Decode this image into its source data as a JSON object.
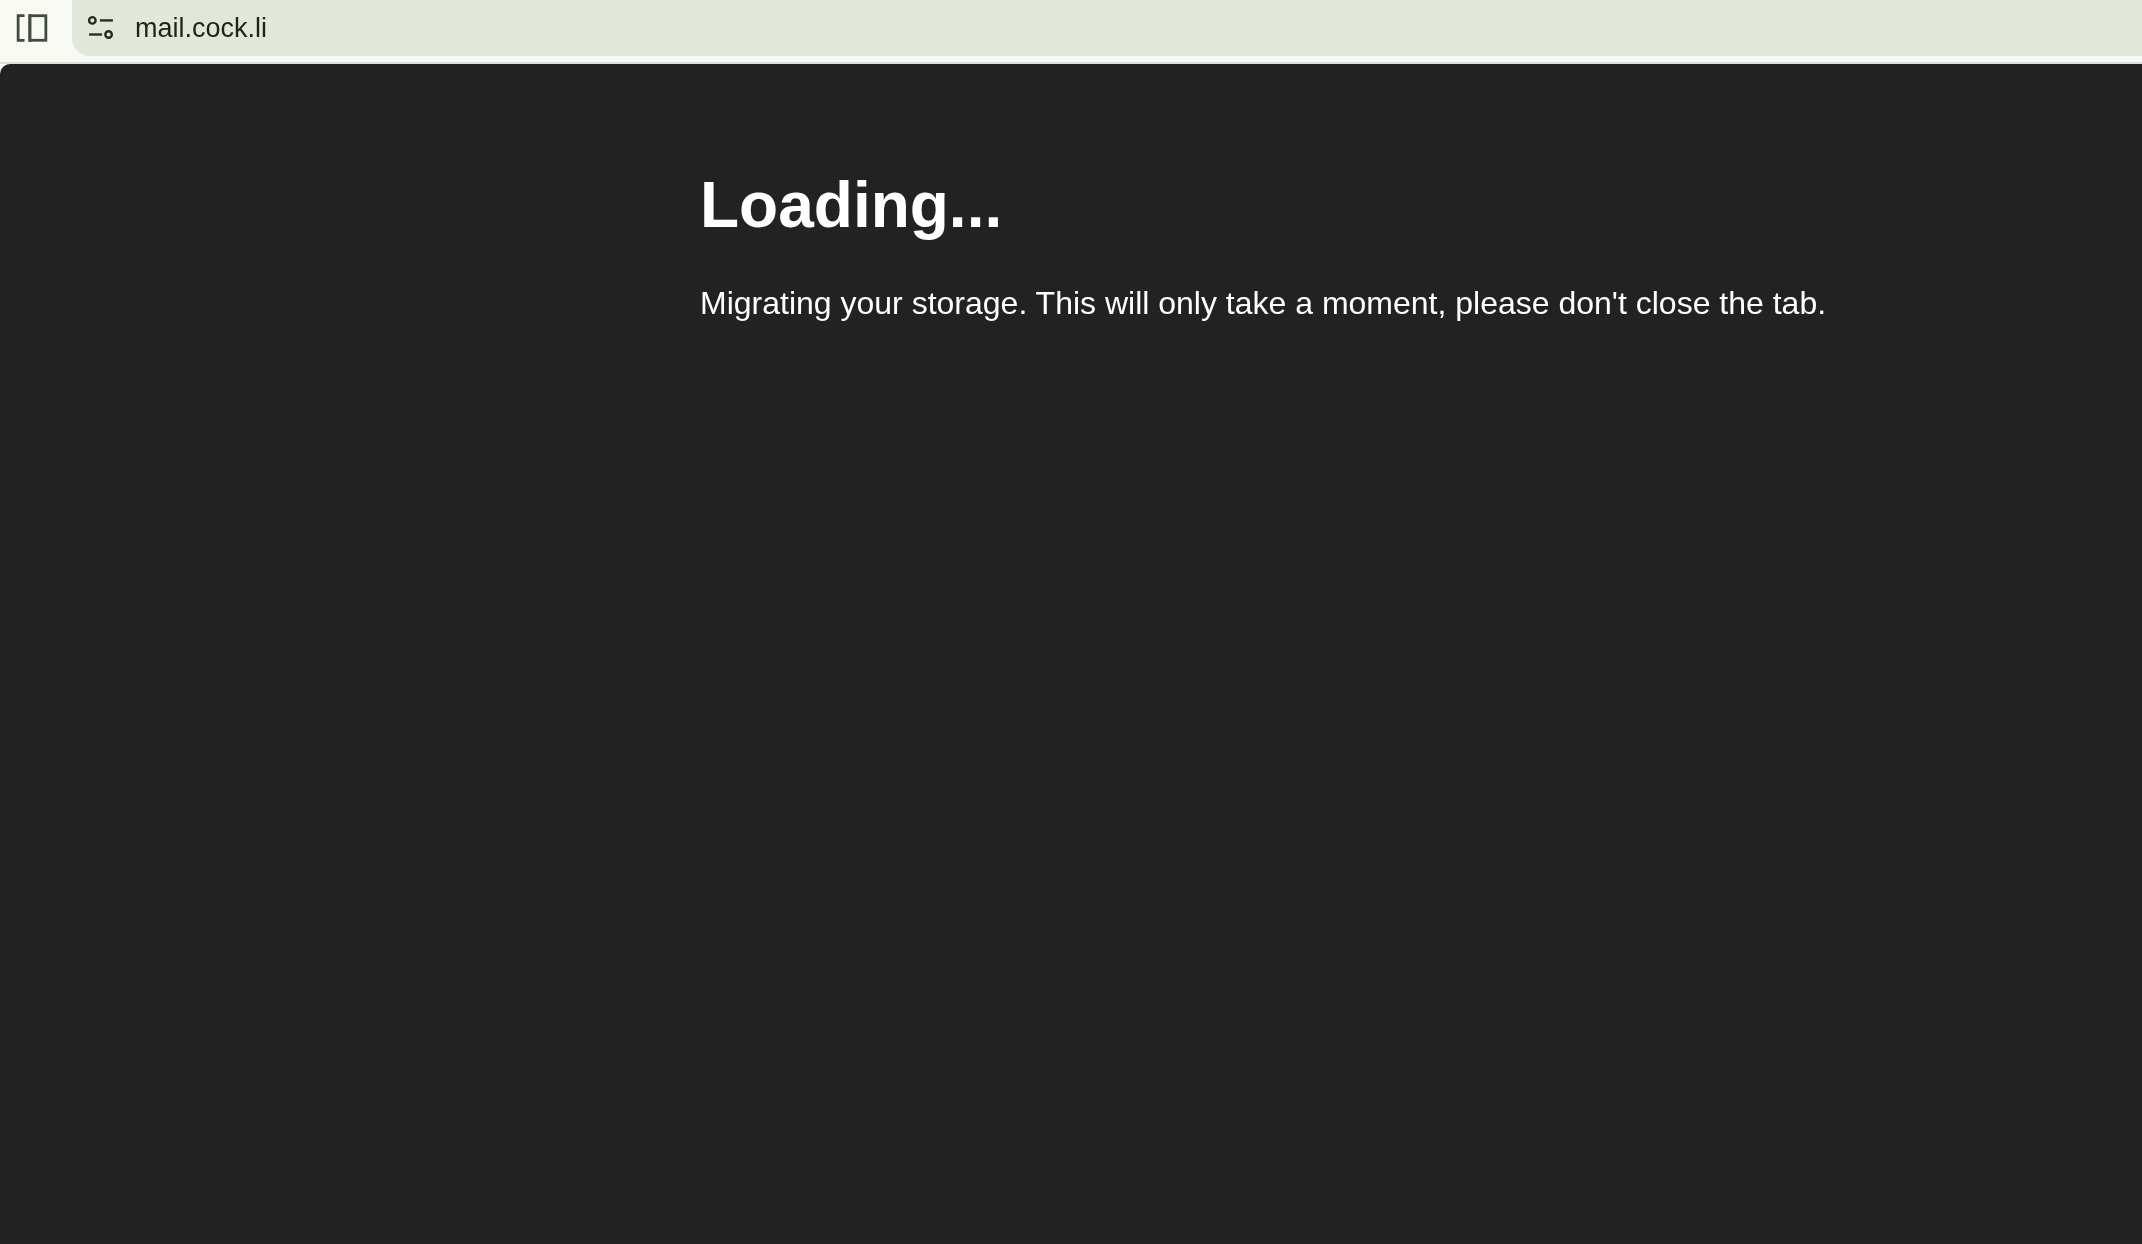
{
  "browser": {
    "url": "mail.cock.li"
  },
  "page": {
    "heading": "Loading...",
    "message": "Migrating your storage. This will only take a moment, please don't close the tab."
  }
}
